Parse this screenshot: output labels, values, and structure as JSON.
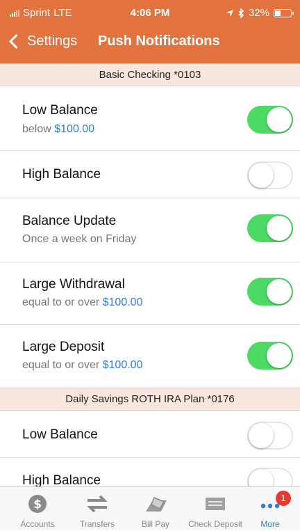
{
  "status_bar": {
    "carrier": "Sprint",
    "network": "LTE",
    "time": "4:06 PM",
    "battery": "32%"
  },
  "nav": {
    "back_label": "Settings",
    "title": "Push Notifications"
  },
  "sections": [
    {
      "title": "Basic Checking *0103",
      "rows": [
        {
          "label": "Low Balance",
          "sub_prefix": "below ",
          "sub_amount": "$100.00",
          "enabled": true
        },
        {
          "label": "High Balance",
          "sub_prefix": "",
          "sub_amount": "",
          "enabled": false
        },
        {
          "label": "Balance Update",
          "sub_prefix": "Once a week on Friday",
          "sub_amount": "",
          "enabled": true
        },
        {
          "label": "Large Withdrawal",
          "sub_prefix": "equal to or over ",
          "sub_amount": "$100.00",
          "enabled": true
        },
        {
          "label": "Large Deposit",
          "sub_prefix": "equal to or over ",
          "sub_amount": "$100.00",
          "enabled": true
        }
      ]
    },
    {
      "title": "Daily Savings ROTH IRA Plan *0176",
      "rows": [
        {
          "label": "Low Balance",
          "sub_prefix": "",
          "sub_amount": "",
          "enabled": false
        },
        {
          "label": "High Balance",
          "sub_prefix": "",
          "sub_amount": "",
          "enabled": false
        }
      ]
    }
  ],
  "tabbar": {
    "tabs": [
      {
        "label": "Accounts",
        "icon": "dollar-coin-icon"
      },
      {
        "label": "Transfers",
        "icon": "transfer-arrows-icon"
      },
      {
        "label": "Bill Pay",
        "icon": "bill-pay-icon"
      },
      {
        "label": "Check Deposit",
        "icon": "check-deposit-icon"
      },
      {
        "label": "More",
        "icon": "more-dots-icon",
        "badge": "1"
      }
    ],
    "active": "More"
  },
  "colors": {
    "header": "#e2733f",
    "toggle_on": "#4cd964",
    "link": "#2f7bd6",
    "section_bg": "#f9e6de",
    "badge": "#e63a2e"
  }
}
